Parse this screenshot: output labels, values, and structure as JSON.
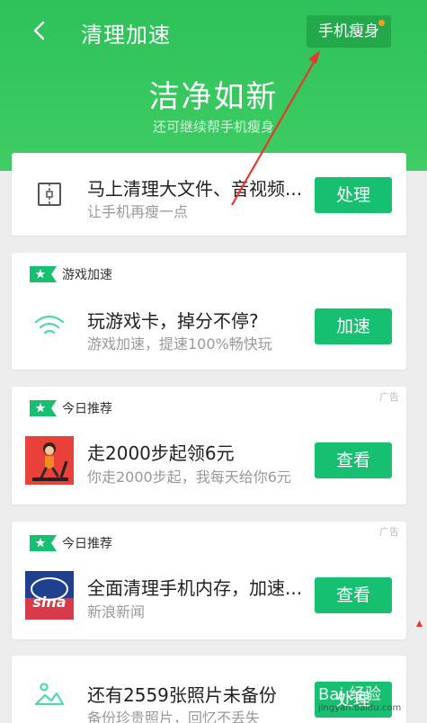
{
  "header": {
    "title": "清理加速",
    "slim_button": "手机瘦身",
    "hero_title": "洁净如新",
    "hero_subtitle": "还可继续帮手机瘦身"
  },
  "cards": [
    {
      "icon": "phone-file-icon",
      "title": "马上清理大文件、音视频...",
      "subtitle": "让手机再瘦一点",
      "button": "处理"
    },
    {
      "tag": "游戏加速",
      "icon": "wifi-icon",
      "title": "玩游戏卡，掉分不停?",
      "subtitle": "游戏加速，提速100%畅快玩",
      "button": "加速"
    },
    {
      "tag": "今日推荐",
      "ad_label": "广告",
      "icon": "treadmill-app-icon",
      "title": "走2000步起领6元",
      "subtitle": "你走2000步起，我每天给你6元",
      "button": "查看"
    },
    {
      "tag": "今日推荐",
      "ad_label": "广告",
      "icon": "sina-news-app-icon",
      "icon_text": "sina",
      "title": "全面清理手机内存，加速...",
      "subtitle": "新浪新闻",
      "button": "查看"
    },
    {
      "icon": "photo-mountain-icon",
      "title": "还有2559张照片未备份",
      "subtitle": "备份珍贵照片，回忆不丢失",
      "button": "处理"
    }
  ],
  "watermark": {
    "text": "Bai 经验",
    "url": "jingyan.baidu.com"
  },
  "colors": {
    "header_green": "#35c55d",
    "button_green": "#17c070",
    "accent_dot": "#ff9c1a",
    "annotation_red": "#e8372c"
  }
}
